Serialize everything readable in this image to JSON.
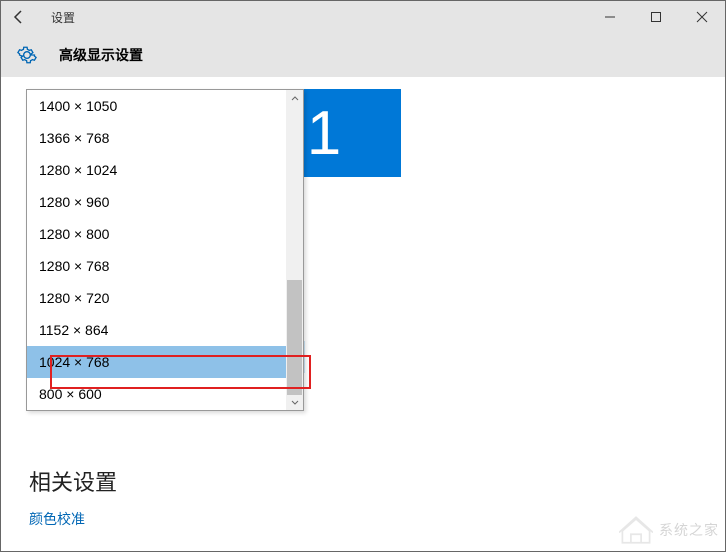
{
  "titlebar": {
    "title": "设置"
  },
  "subheader": {
    "subtitle": "高级显示设置"
  },
  "monitor": {
    "number": "1"
  },
  "dropdown": {
    "items": [
      "1400 × 1050",
      "1366 × 768",
      "1280 × 1024",
      "1280 × 960",
      "1280 × 800",
      "1280 × 768",
      "1280 × 720",
      "1152 × 864",
      "1024 × 768",
      "800 × 600"
    ],
    "selected_index": 8
  },
  "related": {
    "heading": "相关设置",
    "link_color": "颜色校准"
  },
  "watermark": {
    "text": "系统之家"
  }
}
